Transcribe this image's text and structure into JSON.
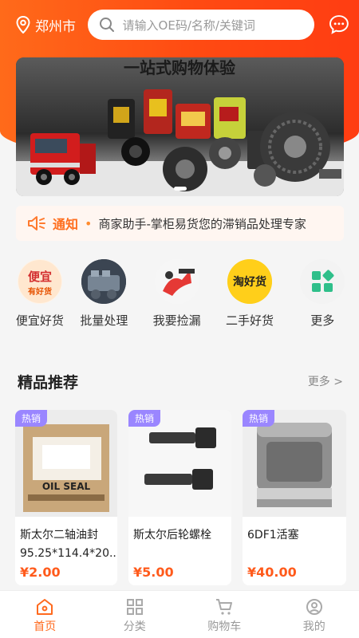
{
  "header": {
    "location": "郑州市",
    "search_placeholder": "请输入OE码/名称/关键词"
  },
  "banner": {
    "caption": "一站式购物体验"
  },
  "notice": {
    "label": "通知",
    "text": "商家助手-掌柜易货您的滞销品处理专家"
  },
  "categories": [
    {
      "label": "便宜好货",
      "icon_text_1": "便宜",
      "icon_text_2": "有好货"
    },
    {
      "label": "批量处理"
    },
    {
      "label": "我要捡漏"
    },
    {
      "label": "二手好货",
      "icon_text": "淘好货"
    },
    {
      "label": "更多"
    }
  ],
  "section": {
    "title": "精品推荐",
    "more": "更多 >"
  },
  "products": [
    {
      "badge": "热销",
      "name": "斯太尔二轴油封95.25*114.4*20...",
      "price": "¥2.00",
      "box_text": "OIL SEAL"
    },
    {
      "badge": "热销",
      "name": "斯太尔后轮螺栓",
      "price": "¥5.00"
    },
    {
      "badge": "热销",
      "name": "6DF1活塞",
      "price": "¥40.00"
    }
  ],
  "tabbar": [
    {
      "label": "首页",
      "active": true
    },
    {
      "label": "分类",
      "active": false
    },
    {
      "label": "购物车",
      "active": false
    },
    {
      "label": "我的",
      "active": false
    }
  ],
  "colors": {
    "brand": "#ff5a1b",
    "badge": "#9a86ff",
    "more_icon": "#2fbf8a"
  }
}
